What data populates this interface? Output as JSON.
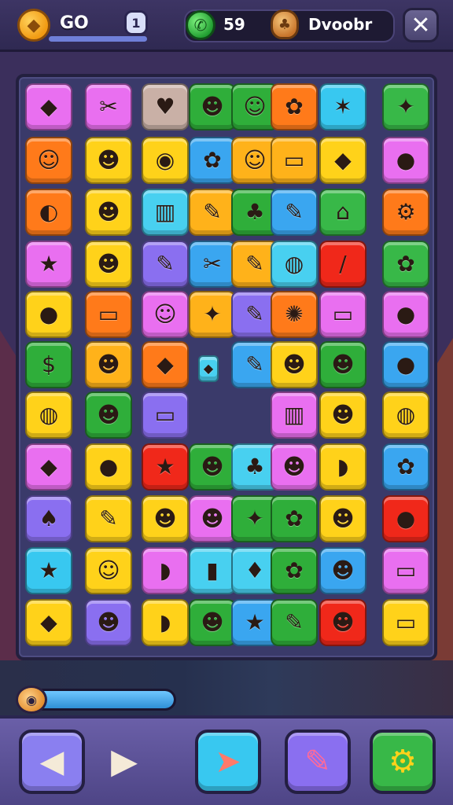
{
  "header": {
    "coin_label": "GO",
    "level_badge": "1",
    "stat_value": "59",
    "stat_name": "Dvoobr",
    "icons": [
      "coin-icon",
      "phone-icon",
      "bag-icon",
      "close-icon"
    ]
  },
  "board": {
    "tiles": [
      {
        "c": 0,
        "r": 0,
        "color": "#e96ff0",
        "glyph": "◆",
        "icon": "green-leaf-icon"
      },
      {
        "c": 1,
        "r": 0,
        "color": "#e96ff0",
        "glyph": "✂",
        "icon": "clip-icon"
      },
      {
        "c": 2,
        "r": 0,
        "color": "#c9b0a6",
        "glyph": "♥",
        "icon": "heart-icon"
      },
      {
        "c": 3,
        "r": 0,
        "color": "#2fae3a",
        "glyph": "☻",
        "icon": "orange-creature-icon"
      },
      {
        "c": 4,
        "r": 0,
        "color": "#2fae3a",
        "glyph": "☺",
        "icon": "orange-face-icon"
      },
      {
        "c": 5,
        "r": 0,
        "color": "#ff7a1a",
        "glyph": "✿",
        "icon": "leaf-icon"
      },
      {
        "c": 6,
        "r": 0,
        "color": "#38c8f0",
        "glyph": "✶",
        "icon": "crown-icon"
      },
      {
        "c": 7,
        "r": 0,
        "color": "#38b848",
        "glyph": "✦",
        "icon": "flower-icon"
      },
      {
        "c": 0,
        "r": 1,
        "color": "#ff7a1a",
        "glyph": "☺",
        "icon": "orange-mask-icon"
      },
      {
        "c": 1,
        "r": 1,
        "color": "#ffd21a",
        "glyph": "☻",
        "icon": "dog-icon"
      },
      {
        "c": 2,
        "r": 1,
        "color": "#ffd21a",
        "glyph": "◉",
        "icon": "purse-icon"
      },
      {
        "c": 3,
        "r": 1,
        "color": "#3aa6f0",
        "glyph": "✿",
        "icon": "pink-creature-icon"
      },
      {
        "c": 4,
        "r": 1,
        "color": "#ffb21a",
        "glyph": "☺",
        "icon": "cookie-icon"
      },
      {
        "c": 5,
        "r": 1,
        "color": "#ffb21a",
        "glyph": "▭",
        "icon": "eraser-icon"
      },
      {
        "c": 6,
        "r": 1,
        "color": "#ffd21a",
        "glyph": "◆",
        "icon": "cloth-icon"
      },
      {
        "c": 7,
        "r": 1,
        "color": "#e96ff0",
        "glyph": "●",
        "icon": "orange-icon"
      },
      {
        "c": 0,
        "r": 2,
        "color": "#ff7a1a",
        "glyph": "◐",
        "icon": "dolphin-icon"
      },
      {
        "c": 1,
        "r": 2,
        "color": "#ffd21a",
        "glyph": "☻",
        "icon": "red-face-icon"
      },
      {
        "c": 2,
        "r": 2,
        "color": "#48d0f0",
        "glyph": "▥",
        "icon": "jar-icon"
      },
      {
        "c": 3,
        "r": 2,
        "color": "#ffb21a",
        "glyph": "✎",
        "icon": "crayon-icon"
      },
      {
        "c": 4,
        "r": 2,
        "color": "#2fae3a",
        "glyph": "♣",
        "icon": "vase-icon"
      },
      {
        "c": 5,
        "r": 2,
        "color": "#3aa6f0",
        "glyph": "✎",
        "icon": "pencil-icon"
      },
      {
        "c": 6,
        "r": 2,
        "color": "#38b848",
        "glyph": "⌂",
        "icon": "house-icon"
      },
      {
        "c": 7,
        "r": 2,
        "color": "#ff7a1a",
        "glyph": "⚙",
        "icon": "tractor-icon"
      },
      {
        "c": 0,
        "r": 3,
        "color": "#e96ff0",
        "glyph": "★",
        "icon": "green-star-icon"
      },
      {
        "c": 1,
        "r": 3,
        "color": "#ffd21a",
        "glyph": "☻",
        "icon": "raccoon-icon"
      },
      {
        "c": 2,
        "r": 3,
        "color": "#8a6ff0",
        "glyph": "✎",
        "icon": "brush-icon"
      },
      {
        "c": 3,
        "r": 3,
        "color": "#3aa6f0",
        "glyph": "✂",
        "icon": "scissors-icon"
      },
      {
        "c": 4,
        "r": 3,
        "color": "#ffb21a",
        "glyph": "✎",
        "icon": "marker-icon"
      },
      {
        "c": 5,
        "r": 3,
        "color": "#48d0f0",
        "glyph": "◍",
        "icon": "ball-icon"
      },
      {
        "c": 6,
        "r": 3,
        "color": "#f0281a",
        "glyph": "/",
        "icon": "red-pencil-icon"
      },
      {
        "c": 7,
        "r": 3,
        "color": "#38b848",
        "glyph": "✿",
        "icon": "yellow-flower-icon"
      },
      {
        "c": 0,
        "r": 4,
        "color": "#ffd21a",
        "glyph": "●",
        "icon": "pumpkin-icon"
      },
      {
        "c": 1,
        "r": 4,
        "color": "#ff7a1a",
        "glyph": "▭",
        "icon": "battery-icon"
      },
      {
        "c": 2,
        "r": 4,
        "color": "#e96ff0",
        "glyph": "☺",
        "icon": "man-face-icon"
      },
      {
        "c": 3,
        "r": 4,
        "color": "#ffb21a",
        "glyph": "✦",
        "icon": "green-bird-icon"
      },
      {
        "c": 4,
        "r": 4,
        "color": "#8a6ff0",
        "glyph": "✎",
        "icon": "blue-marker-icon"
      },
      {
        "c": 5,
        "r": 4,
        "color": "#ff7a1a",
        "glyph": "✺",
        "icon": "sun-gear-icon"
      },
      {
        "c": 6,
        "r": 4,
        "color": "#e96ff0",
        "glyph": "▭",
        "icon": "blue-eraser-icon"
      },
      {
        "c": 7,
        "r": 4,
        "color": "#e96ff0",
        "glyph": "●",
        "icon": "lemon-icon"
      },
      {
        "c": 0,
        "r": 5,
        "color": "#2fae3a",
        "glyph": "$",
        "icon": "money-bag-icon"
      },
      {
        "c": 1,
        "r": 5,
        "color": "#ffb21a",
        "glyph": "☻",
        "icon": "dog-face-icon"
      },
      {
        "c": 2,
        "r": 5,
        "color": "#ff7a1a",
        "glyph": "◆",
        "icon": "green-leaf-icon"
      },
      {
        "c": 4,
        "r": 5,
        "color": "#3aa6f0",
        "glyph": "✎",
        "icon": "pencil-icon"
      },
      {
        "c": 5,
        "r": 5,
        "color": "#ffd21a",
        "glyph": "☻",
        "icon": "blue-cat-icon"
      },
      {
        "c": 6,
        "r": 5,
        "color": "#2fae3a",
        "glyph": "☻",
        "icon": "orange-cat-icon"
      },
      {
        "c": 7,
        "r": 5,
        "color": "#3aa6f0",
        "glyph": "●",
        "icon": "orange-fruit-icon"
      },
      {
        "c": 0,
        "r": 6,
        "color": "#ffd21a",
        "glyph": "◍",
        "icon": "rattle-icon"
      },
      {
        "c": 1,
        "r": 6,
        "color": "#2fae3a",
        "glyph": "☻",
        "icon": "cat-face-icon"
      },
      {
        "c": 2,
        "r": 6,
        "color": "#8a6ff0",
        "glyph": "▭",
        "icon": "eraser-icon"
      },
      {
        "c": 5,
        "r": 6,
        "color": "#e96ff0",
        "glyph": "▥",
        "icon": "temple-icon"
      },
      {
        "c": 6,
        "r": 6,
        "color": "#ffd21a",
        "glyph": "☻",
        "icon": "white-cat-icon"
      },
      {
        "c": 7,
        "r": 6,
        "color": "#ffd21a",
        "glyph": "◍",
        "icon": "blue-candy-icon"
      },
      {
        "c": 0,
        "r": 7,
        "color": "#e96ff0",
        "glyph": "◆",
        "icon": "green-leaf-icon"
      },
      {
        "c": 1,
        "r": 7,
        "color": "#ffd21a",
        "glyph": "●",
        "icon": "tomato-icon"
      },
      {
        "c": 2,
        "r": 7,
        "color": "#f0281a",
        "glyph": "★",
        "icon": "yellow-star-icon"
      },
      {
        "c": 3,
        "r": 7,
        "color": "#2fae3a",
        "glyph": "☻",
        "icon": "bear-icon"
      },
      {
        "c": 4,
        "r": 7,
        "color": "#48d0f0",
        "glyph": "♣",
        "icon": "pear-icon"
      },
      {
        "c": 5,
        "r": 7,
        "color": "#e96ff0",
        "glyph": "☻",
        "icon": "orange-cat-icon"
      },
      {
        "c": 6,
        "r": 7,
        "color": "#ffd21a",
        "glyph": "◗",
        "icon": "bucket-icon"
      },
      {
        "c": 7,
        "r": 7,
        "color": "#3aa6f0",
        "glyph": "✿",
        "icon": "cloud-tree-icon"
      },
      {
        "c": 0,
        "r": 8,
        "color": "#8a6ff0",
        "glyph": "♠",
        "icon": "paddle-icon"
      },
      {
        "c": 1,
        "r": 8,
        "color": "#ffd21a",
        "glyph": "✎",
        "icon": "crayon-icon"
      },
      {
        "c": 2,
        "r": 8,
        "color": "#ffd21a",
        "glyph": "☻",
        "icon": "fox-icon"
      },
      {
        "c": 3,
        "r": 8,
        "color": "#e96ff0",
        "glyph": "☻",
        "icon": "goat-icon"
      },
      {
        "c": 4,
        "r": 8,
        "color": "#2fae3a",
        "glyph": "✦",
        "icon": "bird-icon"
      },
      {
        "c": 5,
        "r": 8,
        "color": "#2fae3a",
        "glyph": "✿",
        "icon": "shell-icon"
      },
      {
        "c": 6,
        "r": 8,
        "color": "#ffd21a",
        "glyph": "☻",
        "icon": "pig-face-icon"
      },
      {
        "c": 7,
        "r": 8,
        "color": "#f0281a",
        "glyph": "●",
        "icon": "pumpkin-icon"
      },
      {
        "c": 0,
        "r": 9,
        "color": "#38c8f0",
        "glyph": "★",
        "icon": "orange-star-icon"
      },
      {
        "c": 1,
        "r": 9,
        "color": "#ffd21a",
        "glyph": "☺",
        "icon": "boy-face-icon"
      },
      {
        "c": 2,
        "r": 9,
        "color": "#e96ff0",
        "glyph": "◗",
        "icon": "bucket-icon"
      },
      {
        "c": 3,
        "r": 9,
        "color": "#48d0f0",
        "glyph": "▮",
        "icon": "bottle-icon"
      },
      {
        "c": 4,
        "r": 9,
        "color": "#48d0f0",
        "glyph": "♦",
        "icon": "vase-icon"
      },
      {
        "c": 5,
        "r": 9,
        "color": "#2fae3a",
        "glyph": "✿",
        "icon": "star-shell-icon"
      },
      {
        "c": 6,
        "r": 9,
        "color": "#3aa6f0",
        "glyph": "☻",
        "icon": "yellow-cat-icon"
      },
      {
        "c": 7,
        "r": 9,
        "color": "#e96ff0",
        "glyph": "▭",
        "icon": "cup-icon"
      },
      {
        "c": 0,
        "r": 10,
        "color": "#ffd21a",
        "glyph": "◆",
        "icon": "seed-icon"
      },
      {
        "c": 1,
        "r": 10,
        "color": "#8a6ff0",
        "glyph": "☻",
        "icon": "bear-face-icon"
      },
      {
        "c": 2,
        "r": 10,
        "color": "#ffd21a",
        "glyph": "◗",
        "icon": "boat-icon"
      },
      {
        "c": 3,
        "r": 10,
        "color": "#2fae3a",
        "glyph": "☻",
        "icon": "hamster-icon"
      },
      {
        "c": 4,
        "r": 10,
        "color": "#3aa6f0",
        "glyph": "★",
        "icon": "pink-star-icon"
      },
      {
        "c": 5,
        "r": 10,
        "color": "#2fae3a",
        "glyph": "✎",
        "icon": "pencil-icon"
      },
      {
        "c": 6,
        "r": 10,
        "color": "#f0281a",
        "glyph": "☻",
        "icon": "white-cat-icon"
      },
      {
        "c": 7,
        "r": 10,
        "color": "#ffd21a",
        "glyph": "▭",
        "icon": "orange-box-icon"
      }
    ],
    "small_tiles": [
      {
        "icon": "small-blue-gem-icon",
        "color": "#48d0f0",
        "glyph": "◆"
      }
    ]
  },
  "progress": {
    "fill_fraction": 1.0,
    "icon": "snail-icon"
  },
  "bottom_nav": [
    {
      "name": "back-button",
      "icon": "arrow-left-icon",
      "glyph": "◀",
      "color": "#8a7ff0",
      "fg": "#f4ead8"
    },
    {
      "name": "play-button",
      "icon": "play-icon",
      "glyph": "▶",
      "color": "transparent",
      "fg": "#f4ead8"
    },
    {
      "name": "send-button",
      "icon": "paper-plane-icon",
      "glyph": "➤",
      "color": "#38c8f0",
      "fg": "#ff7a6a"
    },
    {
      "name": "puzzle-button",
      "icon": "puzzle-piece-icon",
      "glyph": "✎",
      "color": "#8a6ff0",
      "fg": "#ff6a9a"
    },
    {
      "name": "settings-button",
      "icon": "gear-icon",
      "glyph": "⚙",
      "color": "#38b848",
      "fg": "#ffd21a"
    }
  ]
}
